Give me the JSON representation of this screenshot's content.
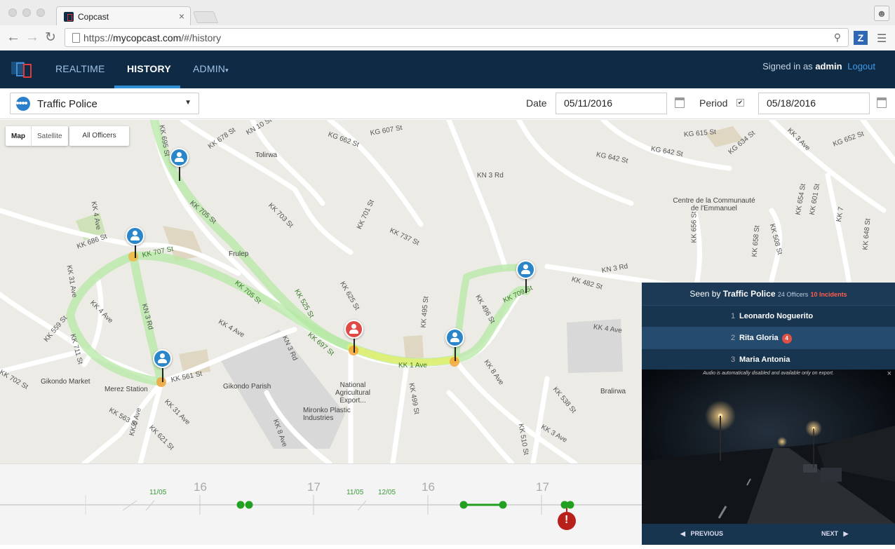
{
  "browser": {
    "tab_title": "Copcast",
    "tab_close": "×",
    "url_prefix": "https://",
    "url_host": "mycopcast.com",
    "url_path": "/#/history",
    "extension_label": "Z"
  },
  "app": {
    "nav": {
      "realtime": "REALTIME",
      "history": "HISTORY",
      "admin": "ADMIN",
      "admin_caret": "▾"
    },
    "signed_in_prefix": "Signed in as",
    "signed_in_user": "admin",
    "logout": "Logout"
  },
  "filters": {
    "group": "Traffic Police",
    "date_label": "Date",
    "date_from": "05/11/2016",
    "period_label": "Period",
    "period_checked": "✔",
    "date_to": "05/18/2016"
  },
  "map": {
    "type_map": "Map",
    "type_satellite": "Satellite",
    "officer_filter": "All Officers",
    "streets": [
      "KK 695 St",
      "KK 678 St",
      "KN 10 St",
      "KG 662 St",
      "KG 607 St",
      "KG 615 St",
      "KK 3 Ave",
      "KG 652 St",
      "KG 642 St",
      "KG 642 St",
      "KG 634 St",
      "KN 3 Rd",
      "KK 705 St",
      "KK 703 St",
      "KK 701 St",
      "KK 737 St",
      "KK 4 Ave",
      "KK 686 St",
      "KK 707 St",
      "KK 31 Ave",
      "KK 4 Ave",
      "KN 3 Rd",
      "KK 705 St",
      "KK 525 St",
      "KK 625 St",
      "KK 4 Ave",
      "KN 3 Rd",
      "KK 697 St",
      "KK 1 Ave",
      "KK 495 St",
      "KK 496 St",
      "KN 3 Rd",
      "KK 482 St",
      "KK 709 St",
      "KK 4 Ave",
      "KK 711 St",
      "KK 559 St",
      "KK 702 St",
      "KK 561 St",
      "KK 563 St",
      "KK 31 Ave",
      "KK 621 St",
      "KK 6 Ave",
      "KK 8 Ave",
      "KK 499 St",
      "KK 8 Ave",
      "KK 538 St",
      "KK 3 Ave",
      "KK 510 St",
      "KK 508 St",
      "KK 656 St",
      "KK 658 St",
      "KK 654 St",
      "KK 601 St",
      "KK 7",
      "KK 648 St"
    ],
    "pois": {
      "tolirwa": "Tolirwa",
      "frulep": "Frulep",
      "centre": "Centre de la Communauté de l'Emmanuel",
      "gikondo_market": "Gikondo Market",
      "merez": "Merez Station",
      "parish": "Gikondo Parish",
      "national": "National Agricultural Export...",
      "mironko": "Mironko Plastic Industries",
      "bralirwa": "Bralirwa"
    }
  },
  "timeline": {
    "ticks": [
      "16",
      "17",
      "16",
      "17"
    ],
    "dates": [
      "11/05",
      "11/05",
      "12/05"
    ],
    "alert": "!"
  },
  "panel": {
    "seen_by": "Seen by",
    "group": "Traffic Police",
    "officers": "24 Officers",
    "incidents": "10 Incidents",
    "officers_list": [
      {
        "num": "1",
        "name": "Leonardo Noguerito",
        "badge": ""
      },
      {
        "num": "2",
        "name": "Rita Gloria",
        "badge": "4"
      },
      {
        "num": "3",
        "name": "Maria Antonia",
        "badge": ""
      }
    ],
    "video_note": "Audio is automatically disabled and available only on export.",
    "video_close": "×",
    "previous": "PREVIOUS",
    "next": "NEXT"
  }
}
